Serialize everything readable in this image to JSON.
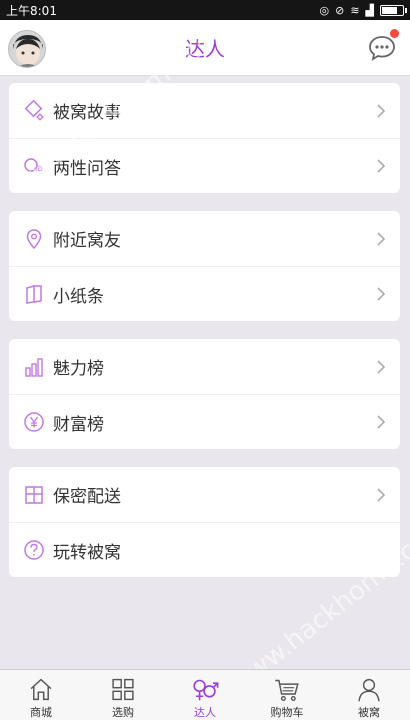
{
  "status": {
    "time": "上午8:01"
  },
  "header": {
    "title": "达人"
  },
  "groups": [
    {
      "items": [
        {
          "label": "被窝故事",
          "icon": "diamond-icon"
        },
        {
          "label": "两性问答",
          "icon": "qa-icon"
        }
      ]
    },
    {
      "items": [
        {
          "label": "附近窝友",
          "icon": "location-pin-icon"
        },
        {
          "label": "小纸条",
          "icon": "note-icon"
        }
      ]
    },
    {
      "items": [
        {
          "label": "魅力榜",
          "icon": "bar-chart-icon"
        },
        {
          "label": "财富榜",
          "icon": "yen-icon"
        }
      ]
    },
    {
      "items": [
        {
          "label": "保密配送",
          "icon": "package-icon"
        },
        {
          "label": "玩转被窝",
          "icon": "question-icon"
        }
      ]
    }
  ],
  "tabs": [
    {
      "label": "商城",
      "icon": "home-icon"
    },
    {
      "label": "选购",
      "icon": "grid-icon"
    },
    {
      "label": "达人",
      "icon": "gender-icon",
      "active": true
    },
    {
      "label": "购物车",
      "icon": "cart-icon"
    },
    {
      "label": "被窝",
      "icon": "user-icon"
    }
  ],
  "colors": {
    "accent": "#9b3fd4",
    "badge": "#f24a3c",
    "background": "#e9e6ee"
  },
  "watermark": "www.hackhome.com"
}
